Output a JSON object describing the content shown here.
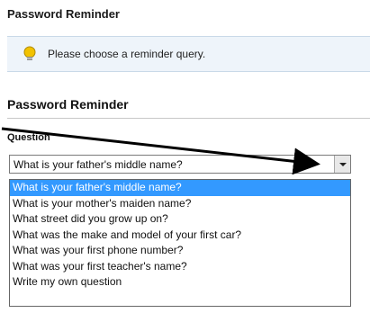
{
  "page": {
    "header_title": "Password Reminder"
  },
  "notice": {
    "icon": "lightbulb-icon",
    "text": "Please choose a reminder query."
  },
  "form": {
    "section_title": "Password Reminder",
    "question_label": "Question",
    "selected_value": "What is your father's middle name?",
    "dropdown_icon": "chevron-down-icon",
    "options": [
      {
        "label": "What is your father's middle name?",
        "selected": true
      },
      {
        "label": "What is your mother's maiden name?",
        "selected": false
      },
      {
        "label": "What street did you grow up on?",
        "selected": false
      },
      {
        "label": "What was the make and model of your first car?",
        "selected": false
      },
      {
        "label": "What was your first phone number?",
        "selected": false
      },
      {
        "label": "What was your first teacher's name?",
        "selected": false
      },
      {
        "label": "Write my own question",
        "selected": false
      }
    ]
  },
  "colors": {
    "selection": "#3399ff",
    "info_background": "#eef4fa",
    "annotation_arrow": "#000000"
  }
}
